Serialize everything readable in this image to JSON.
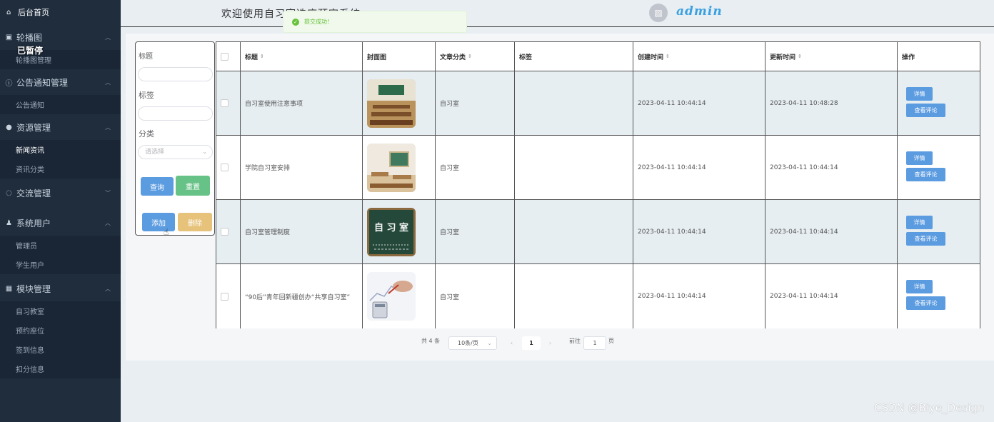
{
  "sidebar": {
    "home_label": "后台首页",
    "paused_label": "已暂停",
    "groups": [
      {
        "label": "轮播图",
        "icon": "image-icon",
        "arrow": "︿",
        "subs": [
          {
            "label": "轮播图管理"
          }
        ]
      },
      {
        "label": "公告通知管理",
        "icon": "info-icon",
        "arrow": "︿",
        "subs": [
          {
            "label": "公告通知"
          }
        ]
      },
      {
        "label": "资源管理",
        "icon": "location-icon",
        "arrow": "︿",
        "subs": [
          {
            "label": "新闻资讯"
          },
          {
            "label": "资讯分类"
          }
        ]
      },
      {
        "label": "交流管理",
        "icon": "chat-icon",
        "arrow": "﹀",
        "subs": []
      },
      {
        "label": "系统用户",
        "icon": "user-icon",
        "arrow": "︿",
        "subs": [
          {
            "label": "管理员"
          },
          {
            "label": "学生用户"
          }
        ]
      },
      {
        "label": "模块管理",
        "icon": "grid-icon",
        "arrow": "︿",
        "subs": [
          {
            "label": "自习教室"
          },
          {
            "label": "预约座位"
          },
          {
            "label": "签到信息"
          },
          {
            "label": "扣分信息"
          }
        ]
      }
    ]
  },
  "header": {
    "welcome": "欢迎使用自习室选座预定系统",
    "username": "admin",
    "toast": "提交成功！"
  },
  "search": {
    "title_label": "标题",
    "tag_label": "标签",
    "category_label": "分类",
    "category_placeholder": "请选择",
    "query_button": "查询",
    "reset_button": "重置",
    "add_button": "添加",
    "delete_button": "删除"
  },
  "table": {
    "headers": [
      "标题",
      "封面图",
      "文章分类",
      "标签",
      "创建时间",
      "更新时间",
      "操作"
    ],
    "detail_label": "详情",
    "comments_label": "查看评论",
    "rows": [
      {
        "title": "自习室使用注意事项",
        "category": "自习室",
        "tag": "",
        "created": "2023-04-11 10:44:14",
        "updated": "2023-04-11 10:48:28"
      },
      {
        "title": "学院自习室安排",
        "category": "自习室",
        "tag": "",
        "created": "2023-04-11 10:44:14",
        "updated": "2023-04-11 10:44:14"
      },
      {
        "title": "自习室管理制度",
        "category": "自习室",
        "tag": "",
        "created": "2023-04-11 10:44:14",
        "updated": "2023-04-11 10:44:14"
      },
      {
        "title": "“90后”青年回新疆创办“共享自习室”",
        "category": "自习室",
        "tag": "",
        "created": "2023-04-11 10:44:14",
        "updated": "2023-04-11 10:44:14"
      }
    ]
  },
  "pagination": {
    "total": "共 4 条",
    "page_size": "10条/页",
    "current_page": "1",
    "goto_label": "前往",
    "goto_value": "1",
    "page_unit": "页"
  },
  "watermark": "CSDN @Biye_Design"
}
